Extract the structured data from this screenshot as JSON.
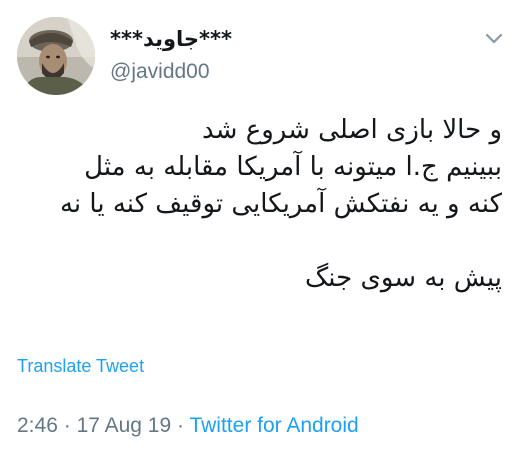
{
  "author": {
    "display_name": "***جاوید***",
    "handle": "@javidd00",
    "avatar": "profile-photo"
  },
  "menu": {
    "icon": "chevron-down-icon"
  },
  "tweet": {
    "lines": [
      "و حالا بازی اصلی شروع شد",
      "ببینیم ج.ا میتونه با آمریکا مقابله به مثل",
      "کنه و یه نفتکش آمریکایی توقیف کنه یا نه"
    ],
    "closing_line": "پیش به سوی جنگ"
  },
  "translate_label": "Translate Tweet",
  "meta": {
    "time": "2:46",
    "separator": "·",
    "date": "17 Aug 19",
    "source": "Twitter for Android"
  },
  "colors": {
    "link": "#1da1f2",
    "secondary_text": "#657786",
    "primary_text": "#14171a"
  }
}
